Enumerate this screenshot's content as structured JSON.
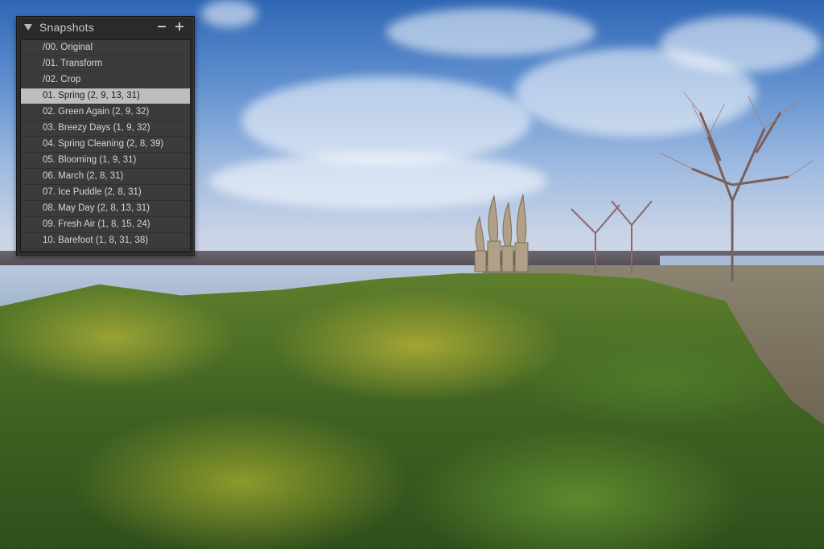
{
  "panel": {
    "title": "Snapshots",
    "disclosure_icon": "disclosure-triangle-icon",
    "remove_icon": "minus-icon",
    "add_icon": "plus-icon"
  },
  "snapshots": [
    {
      "label": "/00. Original"
    },
    {
      "label": "/01. Transform"
    },
    {
      "label": "/02. Crop"
    },
    {
      "label": "01. Spring (2, 9, 13, 31)"
    },
    {
      "label": "02. Green Again (2, 9, 32)"
    },
    {
      "label": "03. Breezy Days (1, 9, 32)"
    },
    {
      "label": "04. Spring Cleaning (2, 8, 39)"
    },
    {
      "label": "05. Blooming (1, 9, 31)"
    },
    {
      "label": "06. March (2, 8, 31)"
    },
    {
      "label": "07. Ice Puddle (2, 8, 31)"
    },
    {
      "label": "08. May Day (2, 8, 13, 31)"
    },
    {
      "label": "09. Fresh Air (1, 8, 15, 24)"
    },
    {
      "label": "10. Barefoot (1, 8, 31, 38)"
    }
  ],
  "selected_index": 3,
  "colors": {
    "panel_bg": "#2a2a2a",
    "list_bg": "#3b3b3b",
    "selected_bg": "#bdbdbd",
    "text": "#d6d6d6"
  }
}
